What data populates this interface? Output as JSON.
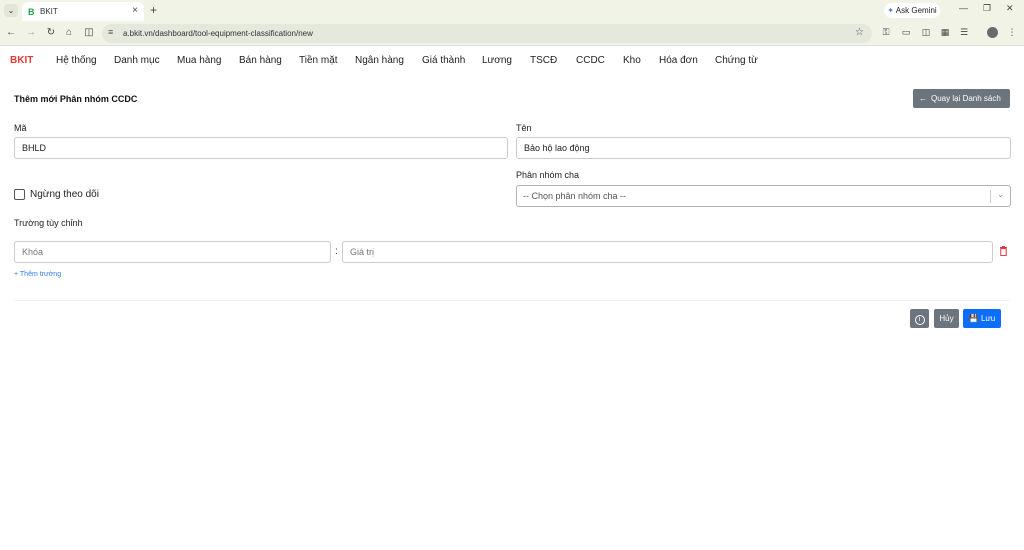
{
  "browser": {
    "tab_title": "BKIT",
    "tab_favicon": "B",
    "url": "a.bkit.vn/dashboard/tool-equipment-classification/new",
    "ask_gemini": "Ask Gemini"
  },
  "app": {
    "brand": "BKIT",
    "nav": [
      "Hệ thống",
      "Danh mục",
      "Mua hàng",
      "Bán hàng",
      "Tiền mặt",
      "Ngân hàng",
      "Giá thành",
      "Lương",
      "TSCĐ",
      "CCDC",
      "Kho",
      "Hóa đơn",
      "Chứng từ"
    ]
  },
  "form": {
    "title": "Thêm mới Phân nhóm CCDC",
    "back_label": "Quay lại Danh sách",
    "code_label": "Mã",
    "code_value": "BHLD",
    "name_label": "Tên",
    "name_value": "Bảo hộ lao động",
    "inactive_label": "Ngừng theo dõi",
    "inactive_checked": false,
    "parent_label": "Phân nhóm cha",
    "parent_placeholder": "-- Chọn phân nhóm cha --",
    "custom_fields_label": "Trường tùy chỉnh",
    "key_placeholder": "Khóa",
    "value_placeholder": "Giá trị",
    "colon": ":",
    "add_field_label": "Thêm trường",
    "cancel_label": "Hủy",
    "save_label": "Lưu"
  },
  "colors": {
    "brand": "#e53935",
    "primary": "#0d6efd",
    "secondary": "#6c757d",
    "danger": "#dc3545",
    "link": "#2f7de1"
  },
  "icons": [
    "tab-menu-icon",
    "close-icon",
    "plus-icon",
    "back-icon",
    "forward-icon",
    "reload-icon",
    "home-icon",
    "sidebar-icon",
    "site-info-icon",
    "star-icon",
    "arrow-left-icon",
    "chevron-down-icon",
    "trash-icon",
    "info-icon",
    "save-icon"
  ]
}
